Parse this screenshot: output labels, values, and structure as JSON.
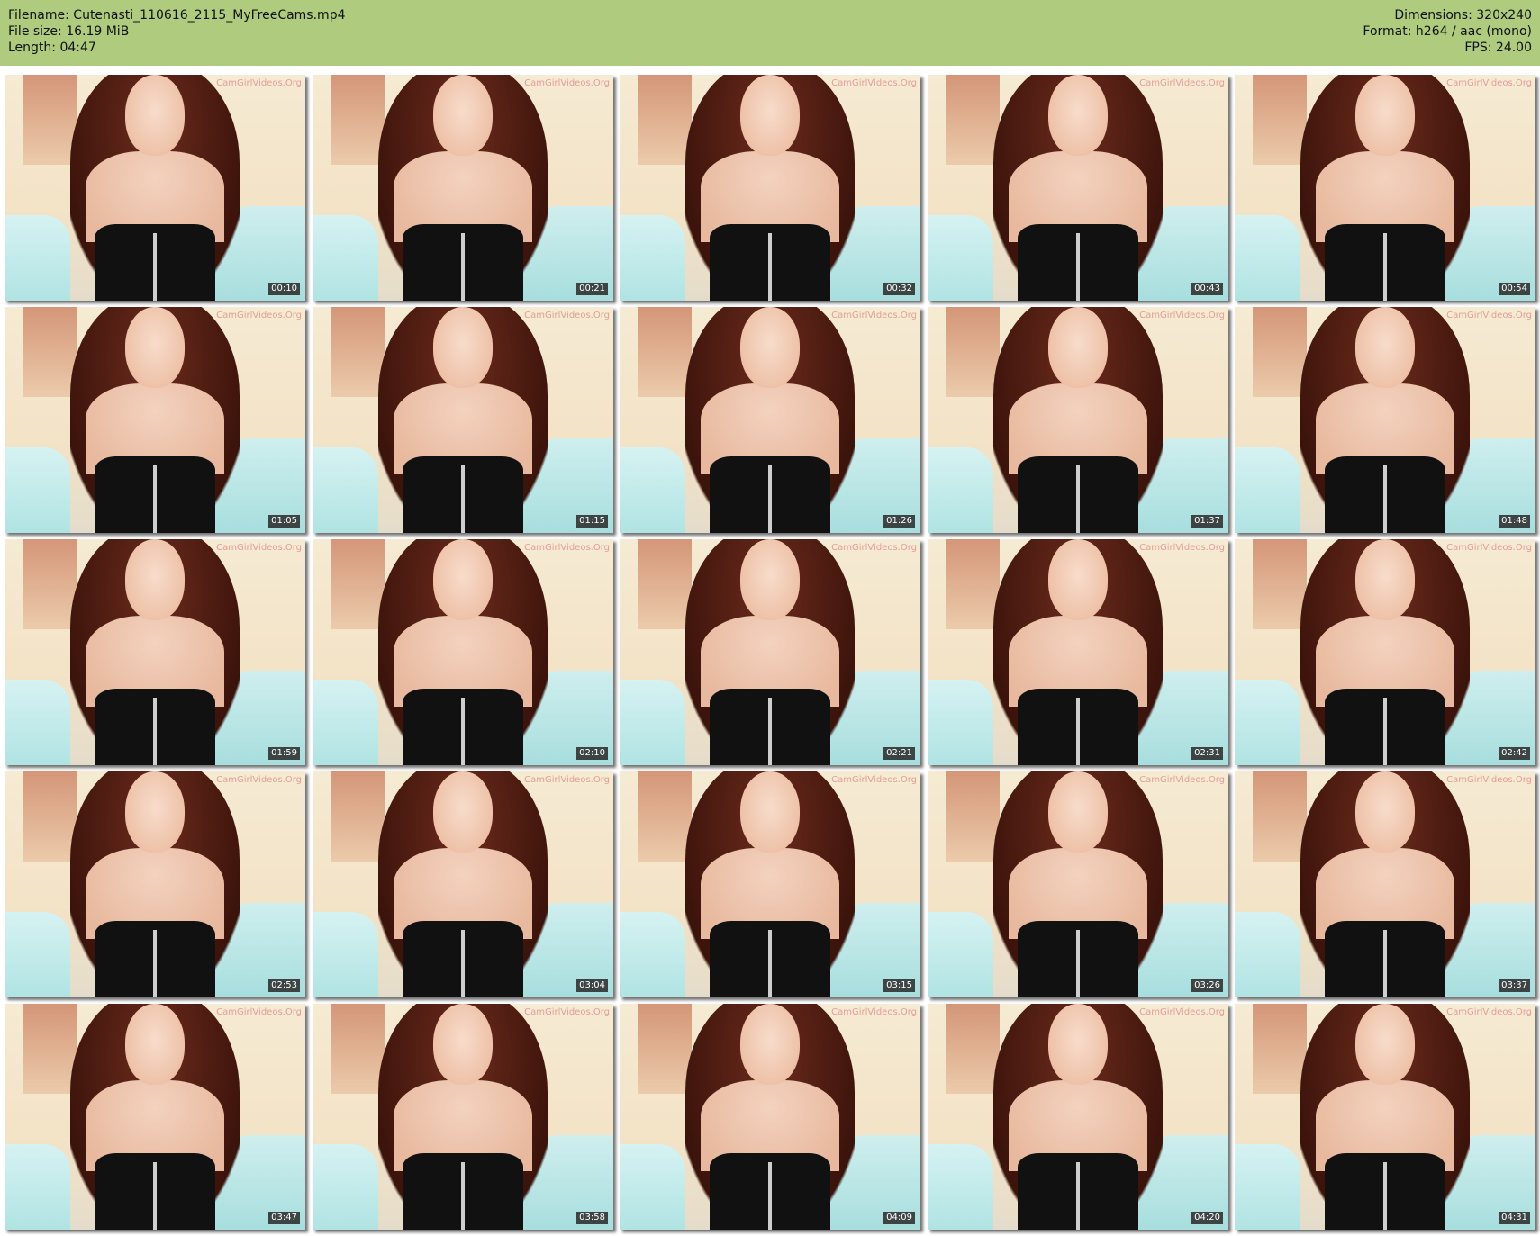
{
  "header": {
    "left_lines": [
      "Filename: Cutenasti_110616_2115_MyFreeCams.mp4",
      "File size: 16.19 MiB",
      "Length: 04:47"
    ],
    "right_lines": [
      "Dimensions: 320x240",
      "Format: h264 / aac (mono)",
      "FPS: 24.00"
    ],
    "background_color": "#aecb7e"
  },
  "watermark": "CamGirlVideos.Org",
  "thumbnails": [
    {
      "timestamp": "00:10"
    },
    {
      "timestamp": "00:21"
    },
    {
      "timestamp": "00:32"
    },
    {
      "timestamp": "00:43"
    },
    {
      "timestamp": "00:54"
    },
    {
      "timestamp": "01:05"
    },
    {
      "timestamp": "01:15"
    },
    {
      "timestamp": "01:26"
    },
    {
      "timestamp": "01:37"
    },
    {
      "timestamp": "01:48"
    },
    {
      "timestamp": "01:59"
    },
    {
      "timestamp": "02:10"
    },
    {
      "timestamp": "02:21"
    },
    {
      "timestamp": "02:31"
    },
    {
      "timestamp": "02:42"
    },
    {
      "timestamp": "02:53"
    },
    {
      "timestamp": "03:04"
    },
    {
      "timestamp": "03:15"
    },
    {
      "timestamp": "03:26"
    },
    {
      "timestamp": "03:37"
    },
    {
      "timestamp": "03:47"
    },
    {
      "timestamp": "03:58"
    },
    {
      "timestamp": "04:09"
    },
    {
      "timestamp": "04:20"
    },
    {
      "timestamp": "04:31"
    }
  ]
}
